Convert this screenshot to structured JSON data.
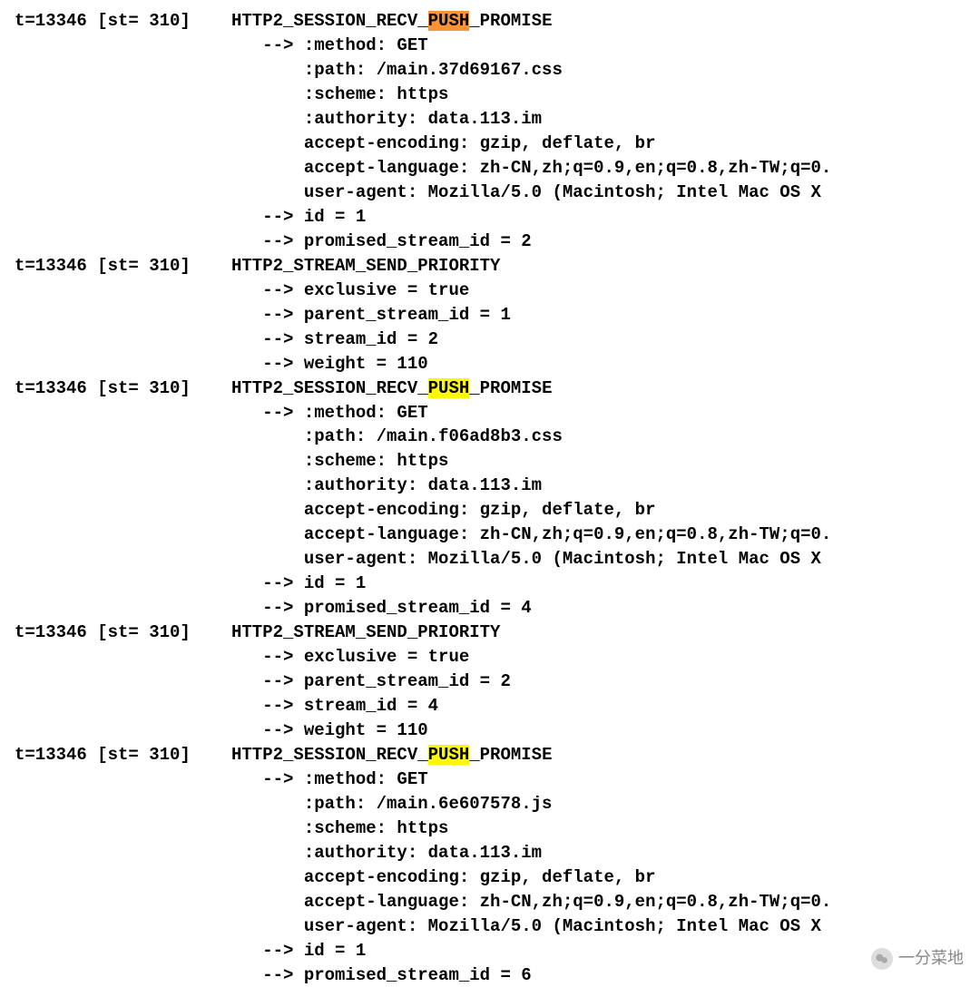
{
  "entries": [
    {
      "time": "t=13346 [st= 310]",
      "event_prefix": "HTTP2_SESSION_RECV_",
      "event_highlight": "PUSH",
      "highlight_class": "hl-orange",
      "event_suffix": "_PROMISE",
      "lines": [
        "--> :method: GET",
        "    :path: /main.37d69167.css",
        "    :scheme: https",
        "    :authority: data.113.im",
        "    accept-encoding: gzip, deflate, br",
        "    accept-language: zh-CN,zh;q=0.9,en;q=0.8,zh-TW;q=0.",
        "    user-agent: Mozilla/5.0 (Macintosh; Intel Mac OS X ",
        "--> id = 1",
        "--> promised_stream_id = 2"
      ]
    },
    {
      "time": "t=13346 [st= 310]",
      "event_prefix": "HTTP2_STREAM_SEND_PRIORITY",
      "event_highlight": "",
      "highlight_class": "",
      "event_suffix": "",
      "lines": [
        "--> exclusive = true",
        "--> parent_stream_id = 1",
        "--> stream_id = 2",
        "--> weight = 110"
      ]
    },
    {
      "time": "t=13346 [st= 310]",
      "event_prefix": "HTTP2_SESSION_RECV_",
      "event_highlight": "PUSH",
      "highlight_class": "hl-yellow",
      "event_suffix": "_PROMISE",
      "lines": [
        "--> :method: GET",
        "    :path: /main.f06ad8b3.css",
        "    :scheme: https",
        "    :authority: data.113.im",
        "    accept-encoding: gzip, deflate, br",
        "    accept-language: zh-CN,zh;q=0.9,en;q=0.8,zh-TW;q=0.",
        "    user-agent: Mozilla/5.0 (Macintosh; Intel Mac OS X ",
        "--> id = 1",
        "--> promised_stream_id = 4"
      ]
    },
    {
      "time": "t=13346 [st= 310]",
      "event_prefix": "HTTP2_STREAM_SEND_PRIORITY",
      "event_highlight": "",
      "highlight_class": "",
      "event_suffix": "",
      "lines": [
        "--> exclusive = true",
        "--> parent_stream_id = 2",
        "--> stream_id = 4",
        "--> weight = 110"
      ]
    },
    {
      "time": "t=13346 [st= 310]",
      "event_prefix": "HTTP2_SESSION_RECV_",
      "event_highlight": "PUSH",
      "highlight_class": "hl-yellow",
      "event_suffix": "_PROMISE",
      "lines": [
        "--> :method: GET",
        "    :path: /main.6e607578.js",
        "    :scheme: https",
        "    :authority: data.113.im",
        "    accept-encoding: gzip, deflate, br",
        "    accept-language: zh-CN,zh;q=0.9,en;q=0.8,zh-TW;q=0.",
        "    user-agent: Mozilla/5.0 (Macintosh; Intel Mac OS X ",
        "--> id = 1",
        "--> promised_stream_id = 6"
      ]
    }
  ],
  "watermark_text": "一分菜地"
}
